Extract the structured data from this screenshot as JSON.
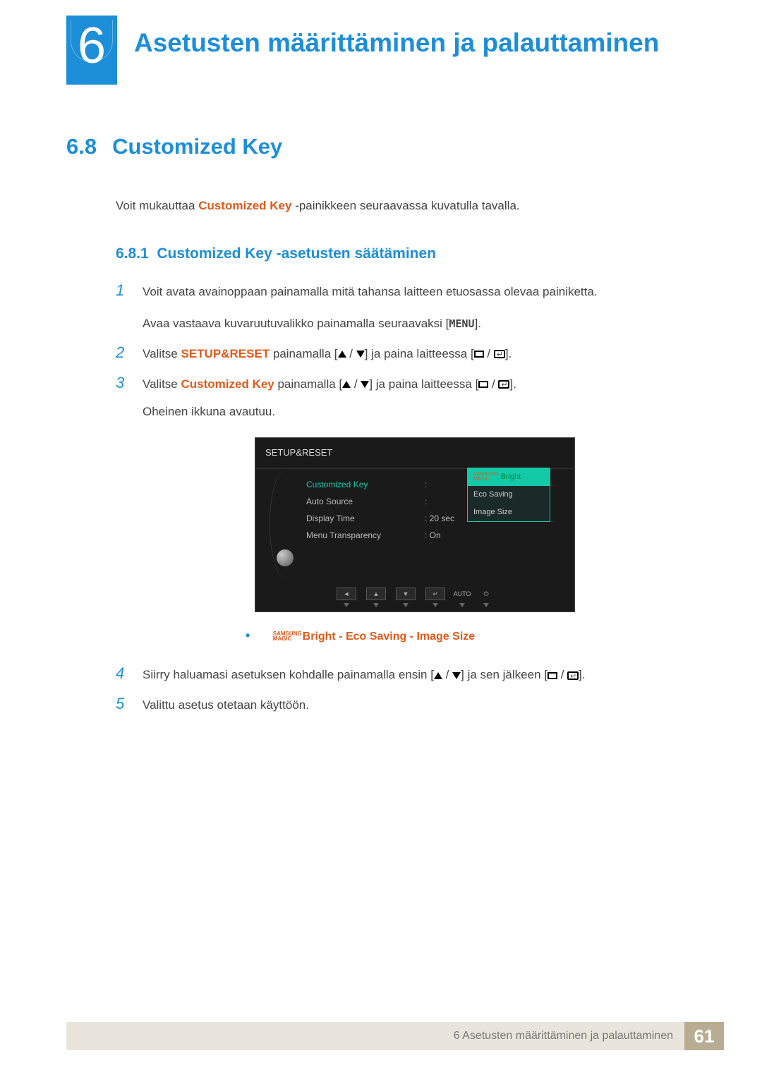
{
  "chapter": {
    "number": "6",
    "title": "Asetusten määrittäminen ja palauttaminen"
  },
  "section": {
    "number": "6.8",
    "title": "Customized Key"
  },
  "intro": {
    "before": "Voit mukauttaa ",
    "bold": "Customized Key",
    "after": " -painikkeen seuraavassa kuvatulla tavalla."
  },
  "subsection": {
    "number": "6.8.1",
    "title": "Customized Key -asetusten säätäminen"
  },
  "steps": {
    "s1": {
      "num": "1",
      "line1": "Voit avata avainoppaan painamalla mitä tahansa laitteen etuosassa olevaa painiketta.",
      "line2a": "Avaa vastaava kuvaruutuvalikko painamalla seuraavaksi [",
      "menu_label": "MENU",
      "line2b": "]."
    },
    "s2": {
      "num": "2",
      "a": "Valitse ",
      "bold": "SETUP&RESET",
      "b": " painamalla [",
      "c": "] ja paina laitteessa [",
      "d": "]."
    },
    "s3": {
      "num": "3",
      "a": "Valitse ",
      "bold": "Customized Key",
      "b": " painamalla [",
      "c": "] ja paina laitteessa [",
      "d": "].",
      "e": "Oheinen ikkuna avautuu."
    },
    "s4": {
      "num": "4",
      "a": "Siirry haluamasi asetuksen kohdalle painamalla ensin [",
      "b": "] ja sen jälkeen [",
      "c": "]."
    },
    "s5": {
      "num": "5",
      "text": "Valittu asetus otetaan käyttöön."
    }
  },
  "osd": {
    "title": "SETUP&RESET",
    "menu": {
      "m1": "Customized Key",
      "m2": "Auto Source",
      "m3": "Display Time",
      "m4": "Menu Transparency"
    },
    "vals": {
      "v3": "20 sec",
      "v4": "On"
    },
    "submenu": {
      "magic_top": "SAMSUNG",
      "magic_bottom": "MAGIC",
      "opt1_suffix": " Bright",
      "opt2": "Eco Saving",
      "opt3": "Image Size"
    },
    "controls": {
      "auto": "AUTO"
    }
  },
  "options_line": {
    "magic_top": "SAMSUNG",
    "magic_bottom": "MAGIC",
    "bright": "Bright",
    "sep": " - ",
    "eco": "Eco Saving",
    "size": "Image Size"
  },
  "footer": {
    "text": "6 Asetusten määrittäminen ja palauttaminen",
    "page": "61"
  }
}
